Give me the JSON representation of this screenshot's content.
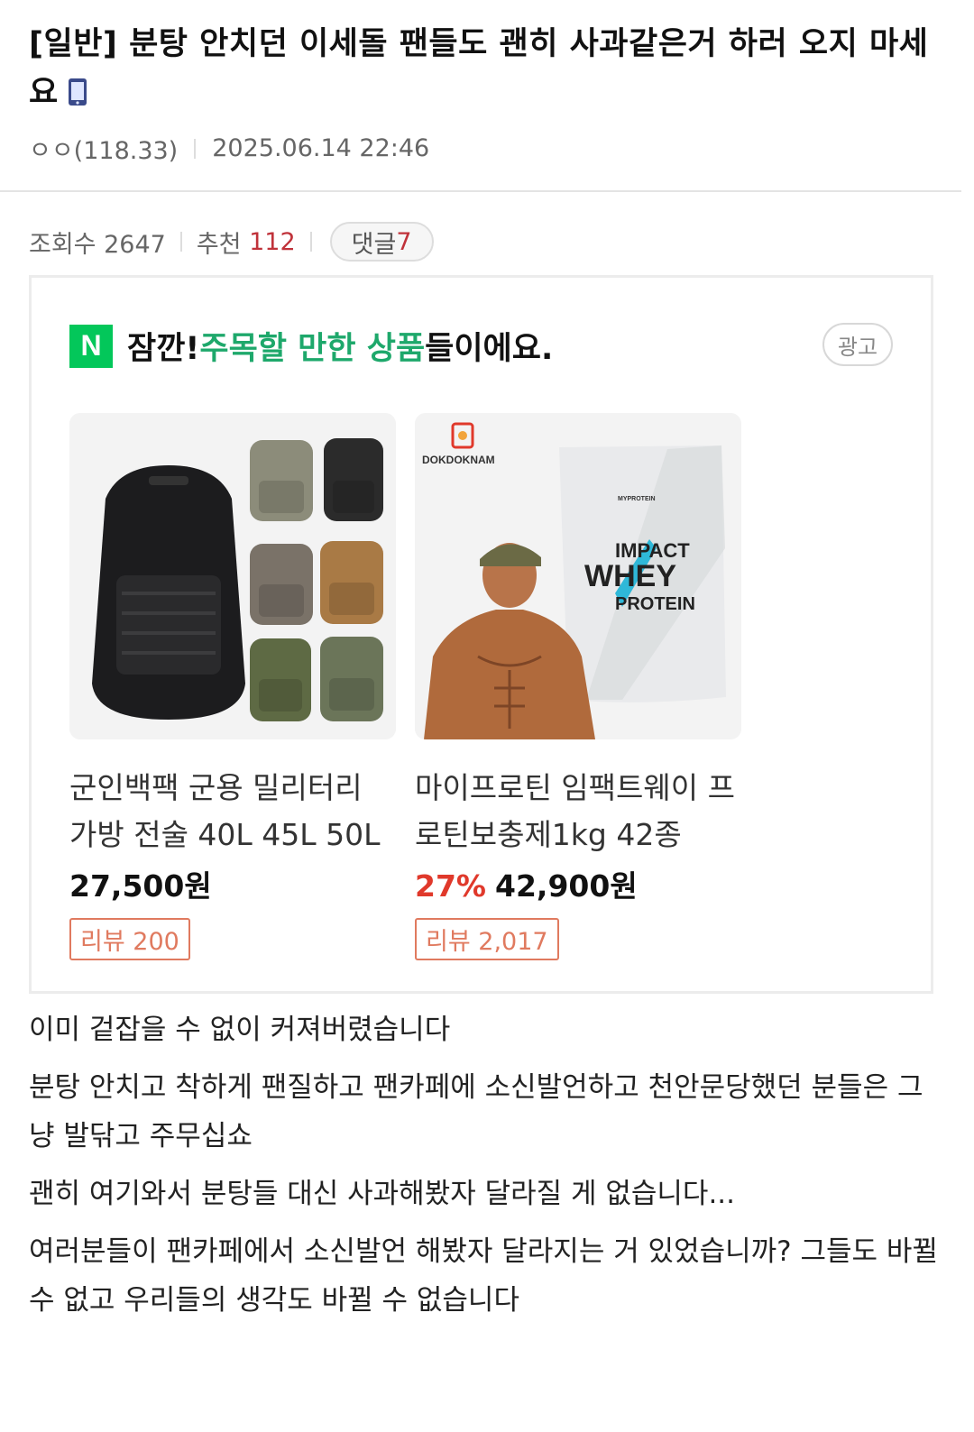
{
  "post": {
    "title": "[일반] 분탕 안치던 이세돌 팬들도 괜히 사과같은거 하러 오지 마세요",
    "author": "ㅇㅇ(118.33)",
    "datetime": "2025.06.14 22:46"
  },
  "stats": {
    "views_label": "조회수 2647",
    "recommend_label": "추천",
    "recommend_count": "112",
    "comment_label": "댓글",
    "comment_count": "7"
  },
  "ad": {
    "logo_letter": "N",
    "heading_prefix": "잠깐! ",
    "heading_highlight": "주목할 만한 상품",
    "heading_suffix": "들이에요.",
    "badge": "광고",
    "products": [
      {
        "name": "군인백팩 군용 밀리터리 가방 전술 40L 45L 50L",
        "discount": "",
        "price": "27,500원",
        "review": "리뷰 200"
      },
      {
        "name": "마이프로틴 임팩트웨이 프로틴보충제1kg 42종",
        "discount": "27%",
        "price": "42,900원",
        "review": "리뷰 2,017",
        "brand_text": "DOKDOKNAM",
        "bag_brand": "MYPROTEIN",
        "bag_line1": "IMPACT",
        "bag_line2": "WHEY",
        "bag_line3": "PROTEIN"
      }
    ]
  },
  "body": {
    "paragraphs": [
      "이미 겉잡을 수 없이 커져버렸습니다",
      "분탕 안치고 착하게 팬질하고 팬카페에 소신발언하고 천안문당했던 분들은 그냥 발닦고 주무십쇼",
      "괜히 여기와서 분탕들 대신 사과해봤자 달라질 게 없습니다...",
      "여러분들이 팬카페에서 소신발언 해봤자 달라지는 거 있었습니까? 그들도 바뀔 수 없고 우리들의 생각도 바뀔 수 없습니다"
    ]
  },
  "colors": {
    "accent_green": "#1ea86b",
    "naver_green": "#03c75a",
    "recommend_red": "#c0323a",
    "discount_red": "#e0392b",
    "review_orange": "#e07a5f"
  }
}
